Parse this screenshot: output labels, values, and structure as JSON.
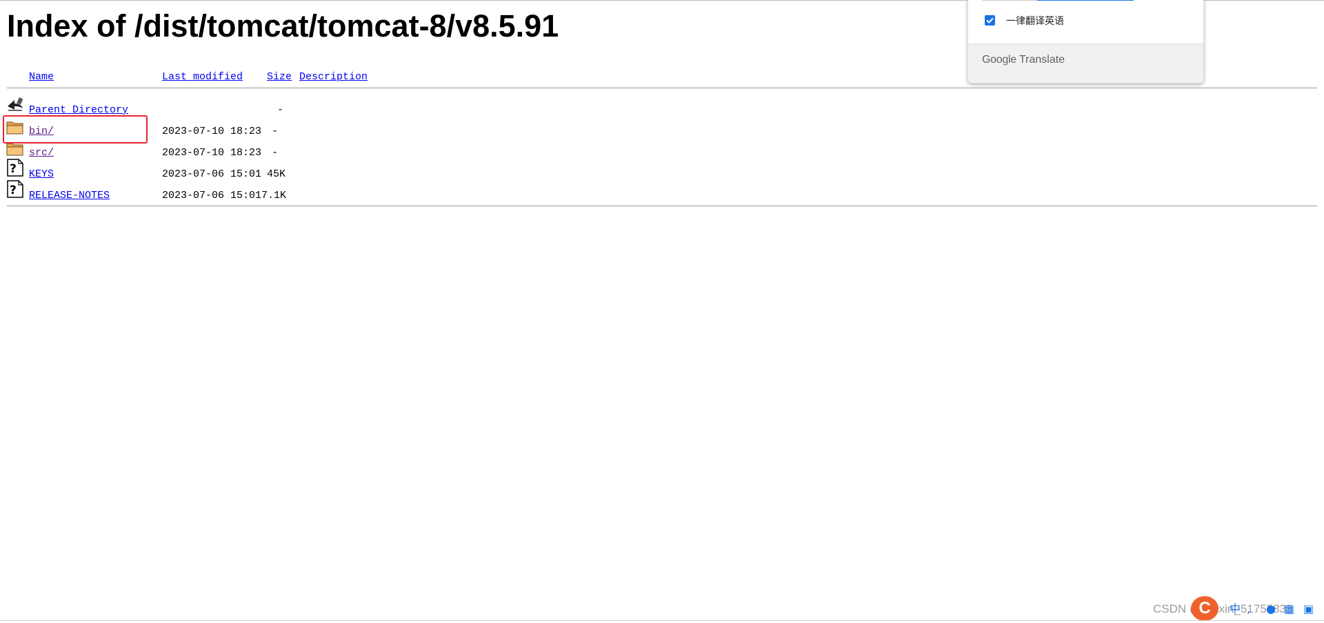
{
  "page": {
    "title": "Index of /dist/tomcat/tomcat-8/v8.5.91"
  },
  "table": {
    "headers": {
      "name": "Name",
      "last_modified": "Last modified",
      "size": "Size",
      "description": "Description"
    },
    "rows": [
      {
        "icon": "back-arrow-icon",
        "name": "Parent Directory",
        "modified": "",
        "size": "-"
      },
      {
        "icon": "folder-icon",
        "name": "bin/",
        "modified": "2023-07-10 18:23",
        "size": "-"
      },
      {
        "icon": "folder-icon",
        "name": "src/",
        "modified": "2023-07-10 18:23",
        "size": "-"
      },
      {
        "icon": "unknown-file-icon",
        "name": "KEYS",
        "modified": "2023-07-06 15:01",
        "size": "45K"
      },
      {
        "icon": "unknown-file-icon",
        "name": "RELEASE-NOTES",
        "modified": "2023-07-06 15:01",
        "size": "7.1K"
      }
    ]
  },
  "translate_popup": {
    "always_translate_label": "一律翻译英语",
    "always_translate_checked": true,
    "brand_google": "Google",
    "brand_translate": "Translate"
  },
  "watermark": {
    "text": "CSDN @weixin_51755833",
    "logo_letter": "C"
  },
  "colors": {
    "link": "#0000ee",
    "visited_link": "#551a8b",
    "highlight_box": "#e8232c",
    "checkbox": "#1a73e8"
  }
}
